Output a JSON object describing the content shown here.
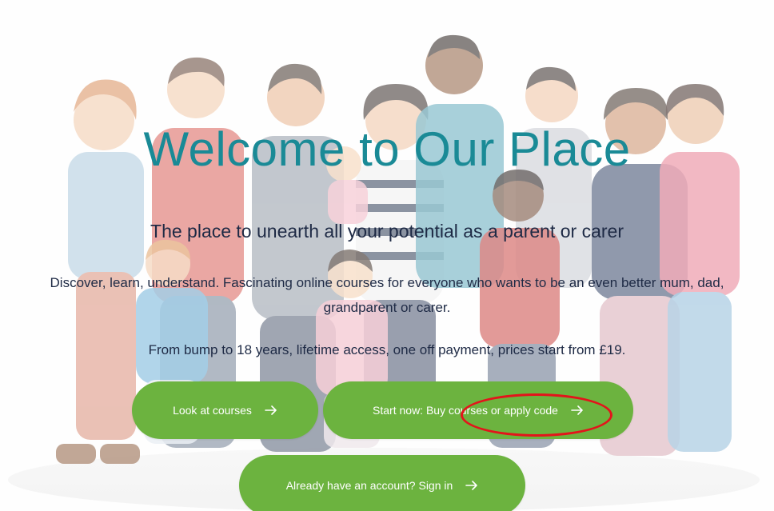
{
  "hero": {
    "title": "Welcome to Our Place",
    "subtitle": "The place to unearth all your potential as a parent or carer",
    "description": "Discover, learn, understand. Fascinating online courses for everyone who wants to be an even better mum, dad, grandparent or carer.",
    "pricing_text": "From bump to 18 years, lifetime access, one off payment, prices start from £19."
  },
  "buttons": {
    "look_at_courses": "Look at courses",
    "start_now": "Start now: Buy courses or apply code",
    "sign_in": "Already have an account? Sign in"
  },
  "icons": {
    "button_arrow": "arrow-right-icon",
    "annotation": "red-circle-highlight"
  },
  "colors": {
    "title": "#1a8a96",
    "body_text": "#1e2a45",
    "button": "#6cb33f",
    "button_text": "#ffffff",
    "annotation": "#e3141b"
  }
}
